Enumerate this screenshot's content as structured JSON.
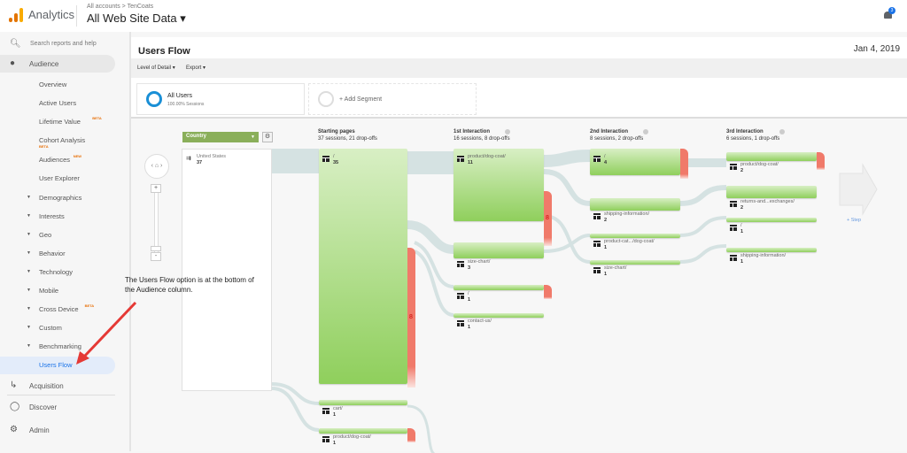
{
  "header": {
    "app_name": "Analytics",
    "breadcrumb": "All accounts > TenCoats",
    "property": "All Web Site Data ▾",
    "notification_count": "3",
    "logo_colors": [
      "#f9ab00",
      "#e37400",
      "#e37400"
    ]
  },
  "sidebar": {
    "search_label": "Search reports and help",
    "audience_label": "Audience",
    "items": [
      {
        "label": "Overview",
        "expandable": false
      },
      {
        "label": "Active Users",
        "expandable": false
      },
      {
        "label": "Lifetime Value",
        "badge": "BETA",
        "expandable": false
      },
      {
        "label": "Cohort Analysis",
        "badge_below": "BETA",
        "expandable": false
      },
      {
        "label": "Audiences",
        "badge": "NEW",
        "expandable": false
      },
      {
        "label": "User Explorer",
        "expandable": false
      },
      {
        "label": "Demographics",
        "expandable": true
      },
      {
        "label": "Interests",
        "expandable": true
      },
      {
        "label": "Geo",
        "expandable": true
      },
      {
        "label": "Behavior",
        "expandable": true
      },
      {
        "label": "Technology",
        "expandable": true
      },
      {
        "label": "Mobile",
        "expandable": true
      },
      {
        "label": "Cross Device",
        "badge": "BETA",
        "expandable": true
      },
      {
        "label": "Custom",
        "expandable": true
      },
      {
        "label": "Benchmarking",
        "expandable": true
      },
      {
        "label": "Users Flow",
        "expandable": false,
        "active": true
      }
    ],
    "bottom": [
      {
        "label": "Acquisition",
        "icon": "acquisition-icon"
      },
      {
        "label": "Discover",
        "icon": "lightbulb-icon"
      },
      {
        "label": "Admin",
        "icon": "gear-icon"
      }
    ]
  },
  "page": {
    "title": "Users Flow",
    "date": "Jan 4, 2019",
    "toolbar": {
      "level_of_detail": "Level of Detail ▾",
      "export": "Export ▾"
    }
  },
  "segments": {
    "all_users": {
      "name": "All Users",
      "sub": "100.00% Sessions",
      "color": "#1a8fd6"
    },
    "add_segment": "+ Add Segment"
  },
  "flow": {
    "dimension_select": "Country",
    "source": {
      "name": "United States",
      "value": "37"
    },
    "columns": [
      {
        "title": "Starting pages",
        "summary": "37 sessions, 21 drop-offs"
      },
      {
        "title": "1st Interaction",
        "summary": "16 sessions, 8 drop-offs"
      },
      {
        "title": "2nd Interaction",
        "summary": "8 sessions, 2 drop-offs"
      },
      {
        "title": "3rd Interaction",
        "summary": "6 sessions, 1 drop-offs"
      }
    ],
    "nodes": {
      "start": [
        {
          "label": "/",
          "value": "35",
          "dropoffs": "8"
        },
        {
          "label": "cart/",
          "value": "1"
        },
        {
          "label": "product/dog-coat/",
          "value": "1"
        }
      ],
      "first": [
        {
          "label": "product/dog-coat/",
          "value": "11",
          "dropoffs": "8"
        },
        {
          "label": "size-chart/",
          "value": "3"
        },
        {
          "label": "/",
          "value": "1"
        },
        {
          "label": "contact-us/",
          "value": "1"
        }
      ],
      "second": [
        {
          "label": "/",
          "value": "4"
        },
        {
          "label": "shipping-information/",
          "value": "2"
        },
        {
          "label": "product-cat.../dog-coat/",
          "value": "1"
        },
        {
          "label": "size-chart/",
          "value": "1"
        }
      ],
      "third": [
        {
          "label": "product/dog-coat/",
          "value": "2"
        },
        {
          "label": "returns-and...exchanges/",
          "value": "2"
        },
        {
          "label": "/",
          "value": "1"
        },
        {
          "label": "shipping-information/",
          "value": "1"
        }
      ]
    },
    "add_step": "+ Step"
  },
  "annotation": {
    "text": "The Users Flow option is at the bottom of the Audience column.",
    "arrow_color": "#e53935"
  }
}
